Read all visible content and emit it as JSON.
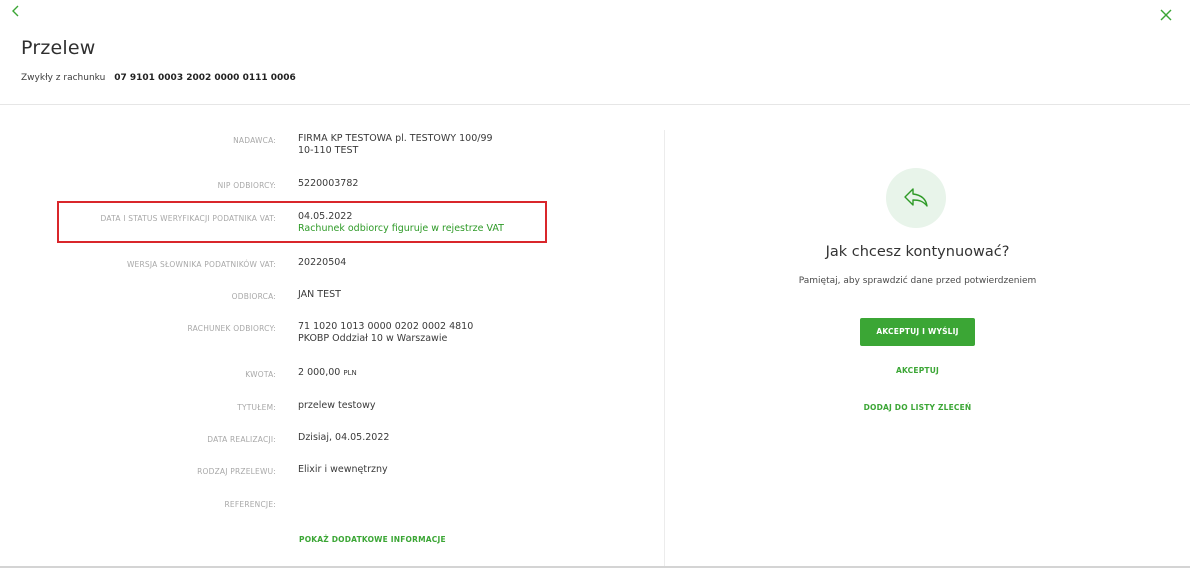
{
  "header": {
    "title": "Przelew",
    "subtitle_label": "Zwykły z rachunku",
    "account_number": "07 9101 0003 2002 0000 0111 0006"
  },
  "details": [
    {
      "label": "NADAWCA:",
      "lines": [
        "FIRMA KP TESTOWA pl. TESTOWY 100/99",
        "10-110 TEST"
      ]
    },
    {
      "label": "NIP ODBIORCY:",
      "lines": [
        "5220003782"
      ]
    },
    {
      "label": "DATA I STATUS WERYFIKACJI PODATNIKA VAT:",
      "lines": [
        "04.05.2022",
        "Rachunek odbiorcy figuruje w rejestrze VAT"
      ]
    },
    {
      "label": "WERSJA SŁOWNIKA PODATNIKÓW VAT:",
      "lines": [
        "20220504"
      ]
    },
    {
      "label": "ODBIORCA:",
      "lines": [
        "JAN TEST"
      ]
    },
    {
      "label": "RACHUNEK ODBIORCY:",
      "lines": [
        "71 1020 1013 0000 0202 0002 4810",
        "PKOBP Oddział 10 w Warszawie"
      ]
    },
    {
      "label": "KWOTA:",
      "amount": "2 000,00",
      "currency": "PLN"
    },
    {
      "label": "TYTUŁEM:",
      "lines": [
        "przelew testowy"
      ]
    },
    {
      "label": "DATA REALIZACJI:",
      "lines": [
        "Dzisiaj, 04.05.2022"
      ]
    },
    {
      "label": "RODZAJ PRZELEWU:",
      "lines": [
        "Elixir i wewnętrzny"
      ]
    },
    {
      "label": "REFERENCJE:",
      "lines": []
    }
  ],
  "show_more_label": "POKAŻ DODATKOWE INFORMACJE",
  "panel": {
    "icon": "share-arrow-icon",
    "title": "Jak chcesz kontynuować?",
    "note": "Pamiętaj, aby sprawdzić dane przed potwierdzeniem",
    "primary_button": "AKCEPTUJ I WYŚLIJ",
    "accept_link": "AKCEPTUJ",
    "add_to_list_link": "DODAJ DO LISTY ZLECEŃ"
  },
  "colors": {
    "accent": "#3ba635",
    "status_green": "#2e9a27",
    "highlight_border": "#d9262b",
    "icon_circle": "#e8f4ea"
  }
}
